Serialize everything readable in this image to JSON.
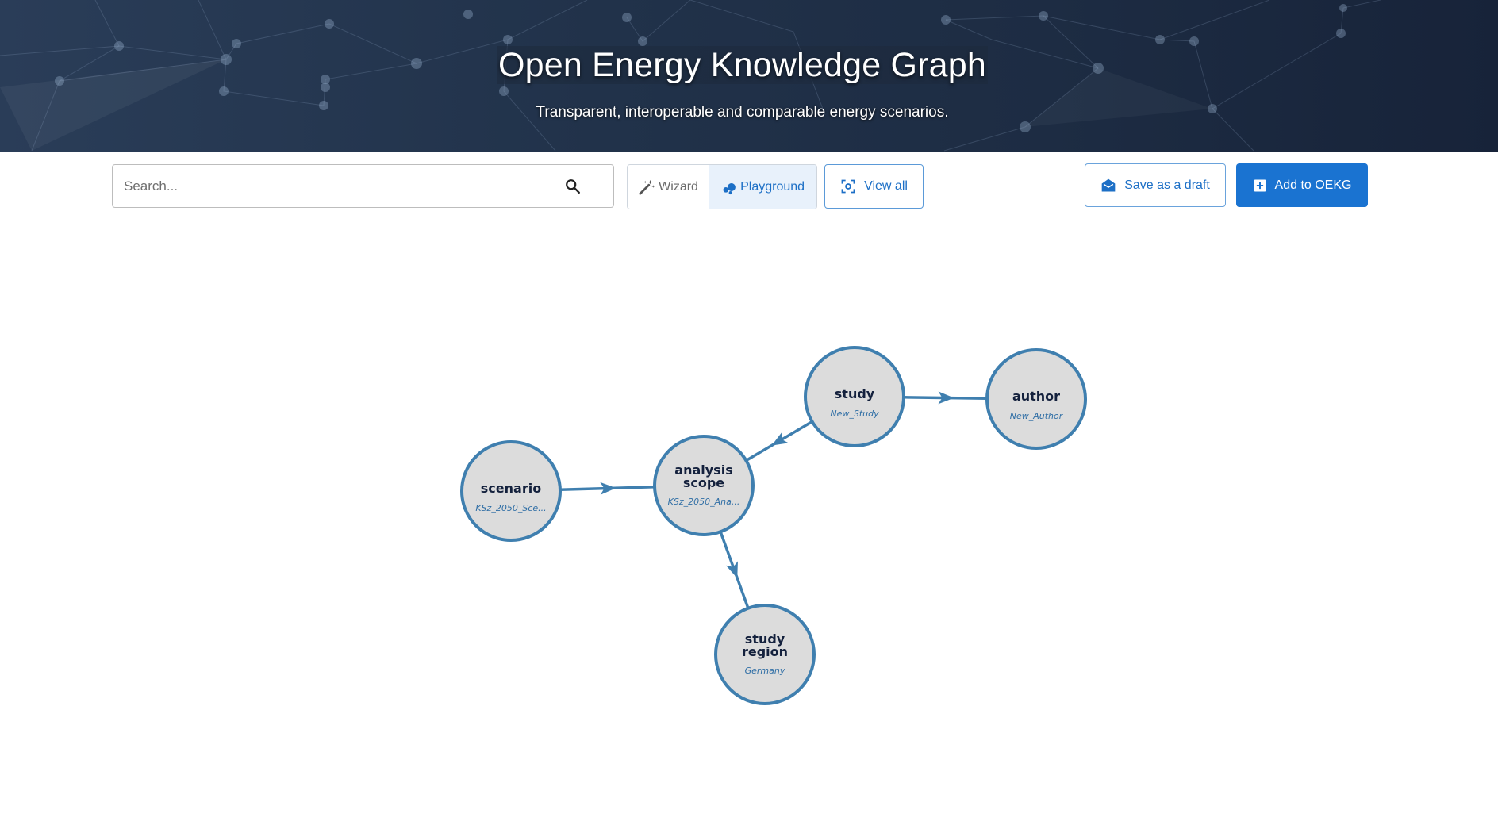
{
  "header": {
    "title": "Open Energy Knowledge Graph",
    "subtitle": "Transparent, interoperable and comparable energy scenarios."
  },
  "search": {
    "placeholder": "Search...",
    "value": ""
  },
  "mode_toggle": {
    "wizard_label": "Wizard",
    "playground_label": "Playground",
    "selected": "Playground"
  },
  "toolbar": {
    "view_all_label": "View all",
    "save_draft_label": "Save as a draft",
    "add_label": "Add to OEKG"
  },
  "colors": {
    "primary": "#1a73d1",
    "node_fill": "#dcdcdc",
    "node_stroke": "#3f7faf",
    "edge": "#3f7faf",
    "header_bg": "#22344c"
  },
  "graph": {
    "nodes": [
      {
        "id": "study",
        "label": [
          "study"
        ],
        "sub": "New_Study"
      },
      {
        "id": "author",
        "label": [
          "author"
        ],
        "sub": "New_Author"
      },
      {
        "id": "scenario",
        "label": [
          "scenario"
        ],
        "sub": "KSz_2050_Sce..."
      },
      {
        "id": "analysis_scope",
        "label": [
          "analysis",
          "scope"
        ],
        "sub": "KSz_2050_Ana..."
      },
      {
        "id": "study_region",
        "label": [
          "study",
          "region"
        ],
        "sub": "Germany"
      }
    ],
    "edges": [
      {
        "from": "study",
        "to": "author"
      },
      {
        "from": "study",
        "to": "analysis_scope"
      },
      {
        "from": "scenario",
        "to": "analysis_scope"
      },
      {
        "from": "analysis_scope",
        "to": "study_region"
      }
    ]
  }
}
